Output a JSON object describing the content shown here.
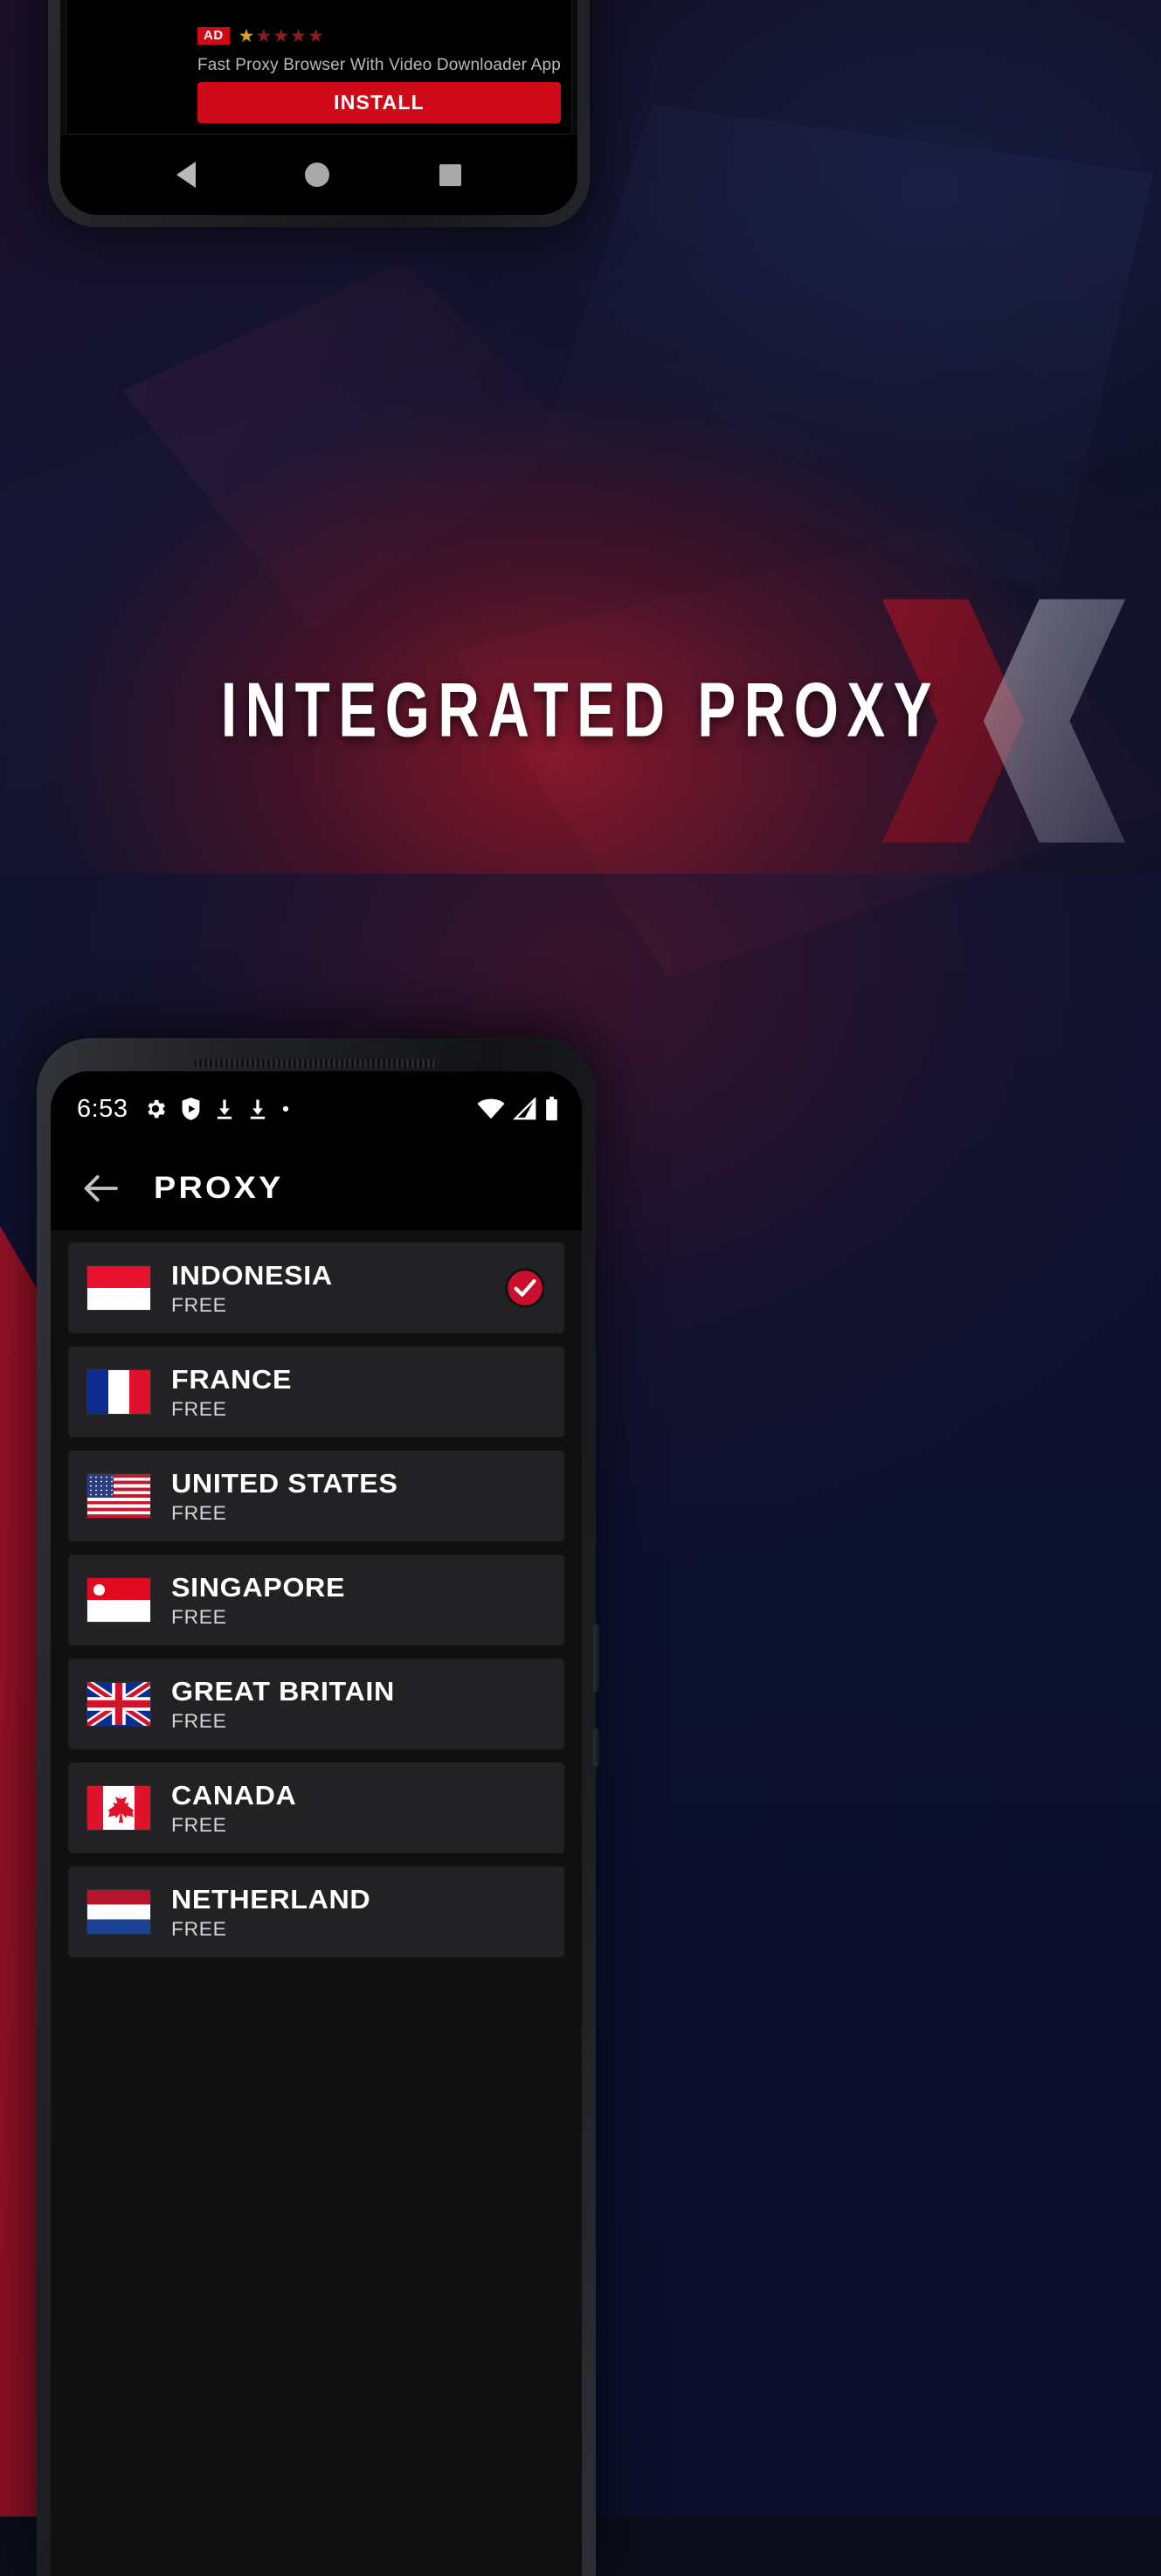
{
  "headline": "INTEGRATED PROXY",
  "colors": {
    "brand_red": "#cf0a18",
    "accent_red": "#c8102e",
    "card_bg": "#222224",
    "list_bg": "#101011",
    "screen_bg": "#000000",
    "text_primary": "#ffffff",
    "text_secondary": "#d4d4d6",
    "bg_navy": "#0d1130",
    "bg_crimson": "#96162 8"
  },
  "top_phone": {
    "ad": {
      "badge": "AD",
      "stars_filled": 1,
      "stars_total": 5,
      "description": "Fast Proxy Browser With Video Downloader App",
      "install_label": "INSTALL"
    },
    "navbar": {
      "back": "back-triangle",
      "home": "home-circle",
      "recents": "recents-square"
    }
  },
  "bottom_phone": {
    "statusbar": {
      "time": "6:53",
      "left_icons": [
        "gear-icon",
        "shield-play-icon",
        "download-icon",
        "download-icon",
        "dot-icon"
      ],
      "right_icons": [
        "wifi-icon",
        "cellular-signal-icon",
        "battery-icon"
      ]
    },
    "appbar": {
      "back_icon": "arrow-left-icon",
      "title": "PROXY"
    },
    "list": {
      "sub_label": "FREE",
      "items": [
        {
          "name": "INDONESIA",
          "status": "FREE",
          "flag": "fl-id",
          "selected": true
        },
        {
          "name": "FRANCE",
          "status": "FREE",
          "flag": "fl-fr",
          "selected": false
        },
        {
          "name": "UNITED STATES",
          "status": "FREE",
          "flag": "fl-us",
          "selected": false
        },
        {
          "name": "SINGAPORE",
          "status": "FREE",
          "flag": "fl-sg",
          "selected": false
        },
        {
          "name": "GREAT BRITAIN",
          "status": "FREE",
          "flag": "fl-gb",
          "selected": false
        },
        {
          "name": "CANADA",
          "status": "FREE",
          "flag": "fl-ca",
          "selected": false
        },
        {
          "name": "NETHERLAND",
          "status": "FREE",
          "flag": "fl-nl",
          "selected": false
        }
      ]
    }
  }
}
